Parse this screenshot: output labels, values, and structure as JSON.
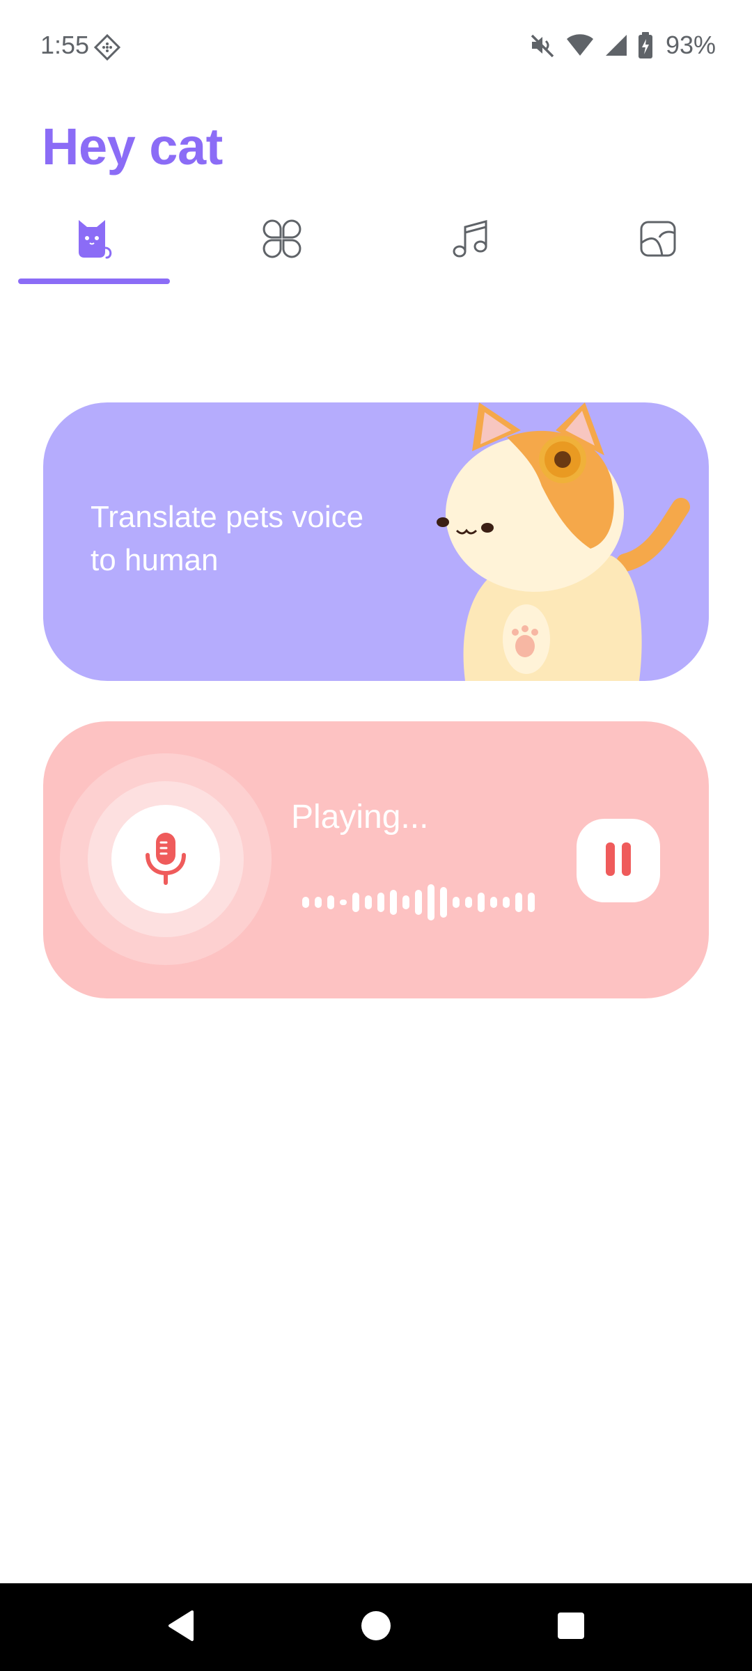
{
  "status_bar": {
    "time": "1:55",
    "battery": "93%",
    "icons": [
      "app-notification-icon",
      "mute-icon",
      "wifi-icon",
      "signal-icon",
      "battery-charging-icon"
    ]
  },
  "header": {
    "title": "Hey cat"
  },
  "tabs": [
    {
      "icon": "cat-icon",
      "selected": true
    },
    {
      "icon": "clover-grid-icon",
      "selected": false
    },
    {
      "icon": "music-note-icon",
      "selected": false
    },
    {
      "icon": "sticker-icon",
      "selected": false
    }
  ],
  "translate_card": {
    "text": "Translate pets voice to human",
    "image": "cat-3d-illustration"
  },
  "player_card": {
    "status": "Playing...",
    "mic_icon": "microphone-icon",
    "pause_icon": "pause-icon"
  },
  "colors": {
    "accent": "#8b6cf6",
    "translate_card_bg": "#b5acfd",
    "player_card_bg": "#fdc2c2",
    "player_accent": "#ef5b5b"
  },
  "nav_bar": {
    "icons": [
      "back-icon",
      "home-icon",
      "recents-icon"
    ]
  }
}
